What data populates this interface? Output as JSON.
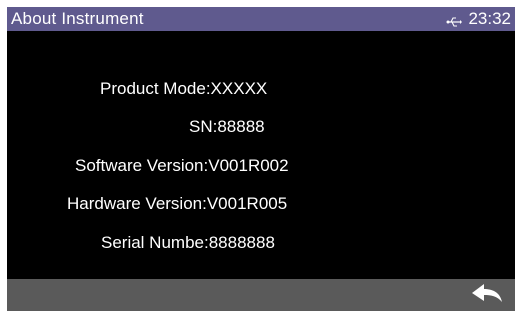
{
  "header": {
    "title": "About Instrument",
    "time": "23:32",
    "status_icon": "usb-icon"
  },
  "info": {
    "product_mode": "Product Mode:XXXXX",
    "sn": "SN:88888",
    "software_version": "Software Version:V001R002",
    "hardware_version": "Hardware Version:V001R005",
    "serial_number": "Serial Numbe:8888888"
  },
  "footer": {
    "back_icon": "back-arrow-icon"
  },
  "colors": {
    "titlebar": "#5f5a8e",
    "background": "#000000",
    "footer": "#5a5a5a",
    "text": "#ffffff"
  }
}
